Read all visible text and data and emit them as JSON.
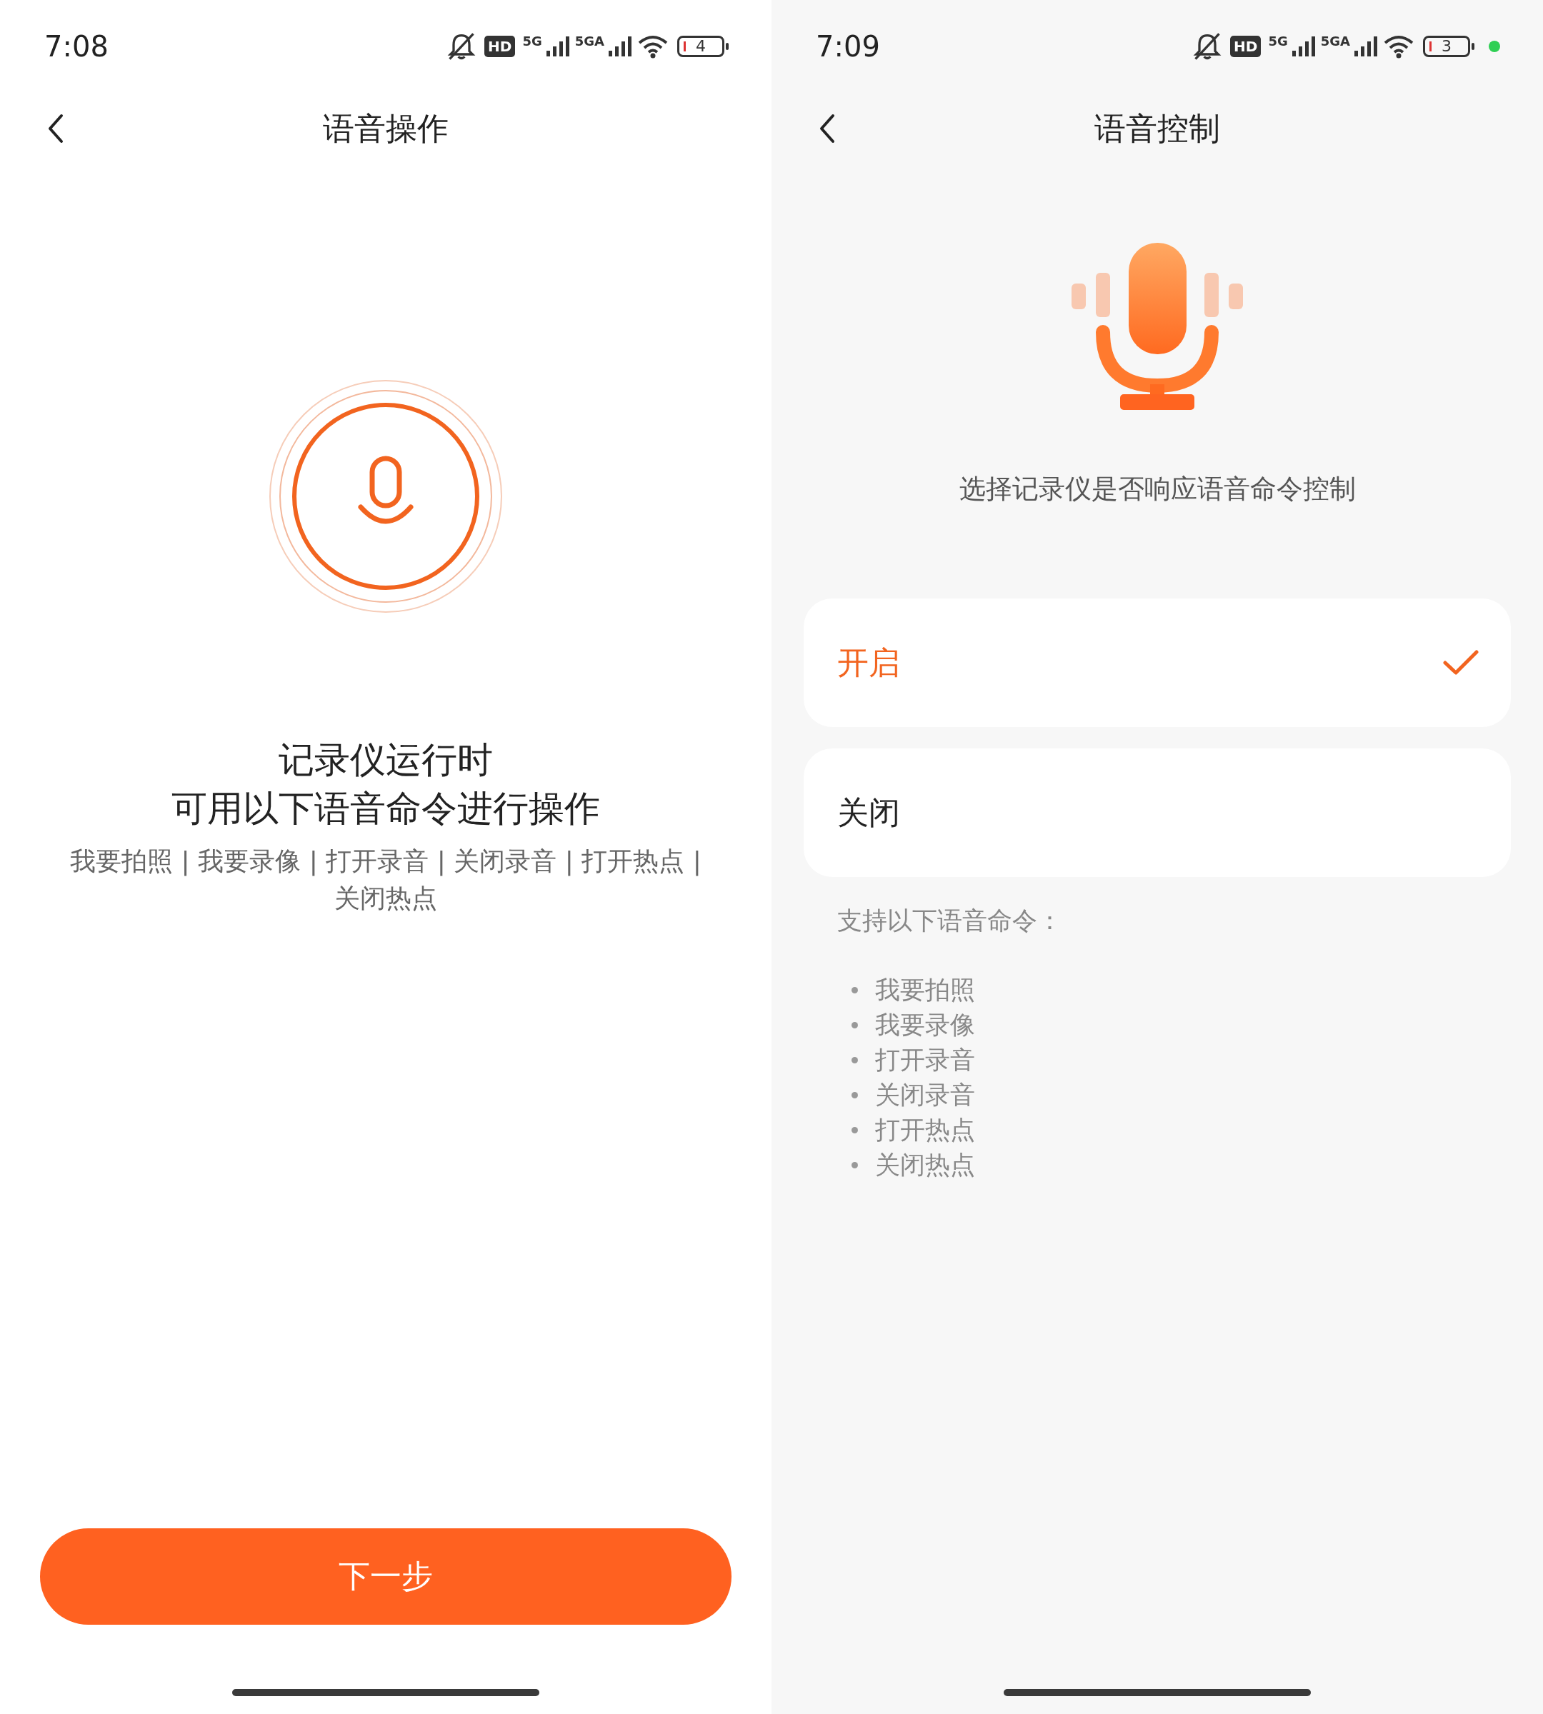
{
  "screens": [
    {
      "status_bar": {
        "time": "7:08",
        "hd_badge": "HD",
        "networks": [
          "5G",
          "5GA"
        ],
        "battery": "4"
      },
      "title": "语音操作",
      "headline": [
        "记录仪运行时",
        "可用以下语音命令进行操作"
      ],
      "commands": "我要拍照 | 我要录像 | 打开录音 | 关闭录音 | 打开热点 | 关闭热点",
      "next_button": "下一步"
    },
    {
      "status_bar": {
        "time": "7:09",
        "hd_badge": "HD",
        "networks": [
          "5G",
          "5GA"
        ],
        "battery": "3",
        "privacy_dot": true
      },
      "title": "语音控制",
      "subtitle": "选择记录仪是否响应语音命令控制",
      "options": [
        {
          "label": "开启",
          "selected": true
        },
        {
          "label": "关闭",
          "selected": false
        }
      ],
      "support_label": "支持以下语音命令：",
      "commands_list": [
        "我要拍照",
        "我要录像",
        "打开录音",
        "关闭录音",
        "打开热点",
        "关闭热点"
      ]
    }
  ]
}
